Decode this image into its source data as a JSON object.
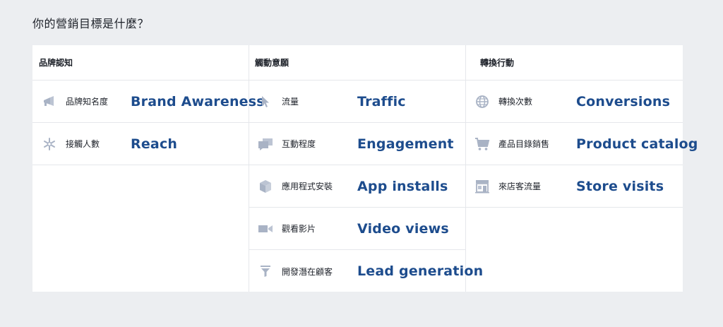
{
  "question": "你的營銷目標是什麼？",
  "colors": {
    "background": "#eceef1",
    "panel": "#ffffff",
    "english_label": "#1d4c8d",
    "icon": "#a9b3c5",
    "divider": "#e5e7eb"
  },
  "columns": [
    {
      "header": "品牌認知",
      "items": [
        {
          "zh": "品牌知名度",
          "en": "Brand Awareness",
          "icon": "megaphone-icon"
        },
        {
          "zh": "接觸人數",
          "en": "Reach",
          "icon": "asterisk-icon"
        }
      ]
    },
    {
      "header": "觸動意願",
      "items": [
        {
          "zh": "流量",
          "en": "Traffic",
          "icon": "cursor-icon"
        },
        {
          "zh": "互動程度",
          "en": "Engagement",
          "icon": "chat-bubbles-icon"
        },
        {
          "zh": "應用程式安裝",
          "en": "App installs",
          "icon": "box-icon"
        },
        {
          "zh": "觀看影片",
          "en": "Video views",
          "icon": "video-camera-icon"
        },
        {
          "zh": "開發潛在顧客",
          "en": "Lead generation",
          "icon": "funnel-icon"
        }
      ]
    },
    {
      "header": "轉換行動",
      "items": [
        {
          "zh": "轉換次數",
          "en": "Conversions",
          "icon": "globe-icon"
        },
        {
          "zh": "產品目錄銷售",
          "en": "Product catalog",
          "icon": "shopping-cart-icon"
        },
        {
          "zh": "來店客流量",
          "en": "Store visits",
          "icon": "storefront-icon"
        }
      ]
    }
  ]
}
